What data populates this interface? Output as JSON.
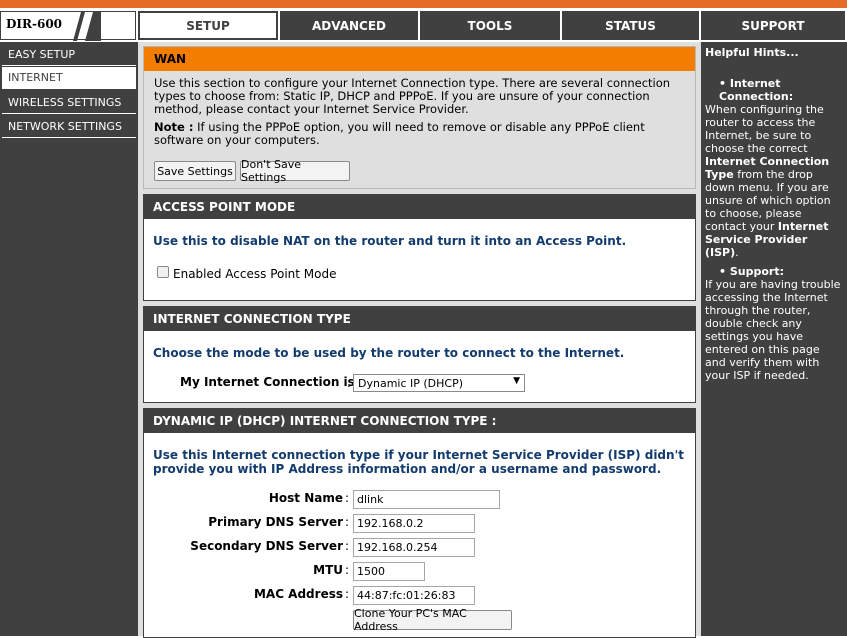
{
  "brand": {
    "name": "DIR-600"
  },
  "tabs": [
    {
      "label": "SETUP",
      "active": true
    },
    {
      "label": "ADVANCED"
    },
    {
      "label": "TOOLS"
    },
    {
      "label": "STATUS"
    },
    {
      "label": "SUPPORT"
    }
  ],
  "sidebar": {
    "items": [
      {
        "label": "EASY SETUP"
      },
      {
        "label": "INTERNET",
        "active": true
      },
      {
        "label": "WIRELESS SETTINGS"
      },
      {
        "label": "NETWORK SETTINGS"
      }
    ]
  },
  "wan": {
    "title": "WAN",
    "description": "Use this section to configure your Internet Connection type. There are several connection types to choose from: Static IP, DHCP and PPPoE. If you are unsure of your connection method, please contact your Internet Service Provider.",
    "note_label": "Note :",
    "note_text": "If using the PPPoE option, you will need to remove or disable any PPPoE client software on your computers.",
    "save_label": "Save Settings",
    "dont_save_label": "Don't Save Settings"
  },
  "access_point": {
    "title": "ACCESS POINT MODE",
    "description": "Use this to disable NAT on the router and turn it into an Access Point.",
    "checkbox_label": "Enabled Access Point Mode",
    "checked": false
  },
  "connection_type": {
    "title": "INTERNET CONNECTION TYPE",
    "description": "Choose the mode to be used by the router to connect to the Internet.",
    "field_label": "My Internet Connection is",
    "selected": "Dynamic IP (DHCP)"
  },
  "dhcp": {
    "title": "DYNAMIC IP (DHCP) INTERNET CONNECTION TYPE :",
    "description": "Use this Internet connection type if your Internet Service Provider (ISP) didn't provide you with IP Address information and/or a username and password.",
    "fields": {
      "host_name": {
        "label": "Host Name",
        "value": "dlink"
      },
      "primary_dns": {
        "label": "Primary DNS Server",
        "value": "192.168.0.2"
      },
      "secondary_dns": {
        "label": "Secondary DNS Server",
        "value": "192.168.0.254"
      },
      "mtu": {
        "label": "MTU",
        "value": "1500"
      },
      "mac": {
        "label": "MAC Address",
        "value": "44:87:fc:01:26:83"
      }
    },
    "clone_label": "Clone Your PC's MAC Address"
  },
  "hints": {
    "title": "Helpful Hints...",
    "internet": {
      "heading": "Internet Connection:",
      "text1": "When configuring the router to access the Internet, be sure to choose the correct ",
      "bold1": "Internet Connection Type",
      "text2": " from the drop down menu. If you are unsure of which option to choose, please contact your ",
      "bold2": "Internet Service Provider (ISP)",
      "text3": "."
    },
    "support": {
      "heading": "Support:",
      "text": "If you are having trouble accessing the Internet through the router, double check any settings you have entered on this page and verify them with your ISP if needed."
    }
  },
  "colors": {
    "accent": "#f27d00",
    "dark": "#404040",
    "link_blue": "#143b6e"
  }
}
